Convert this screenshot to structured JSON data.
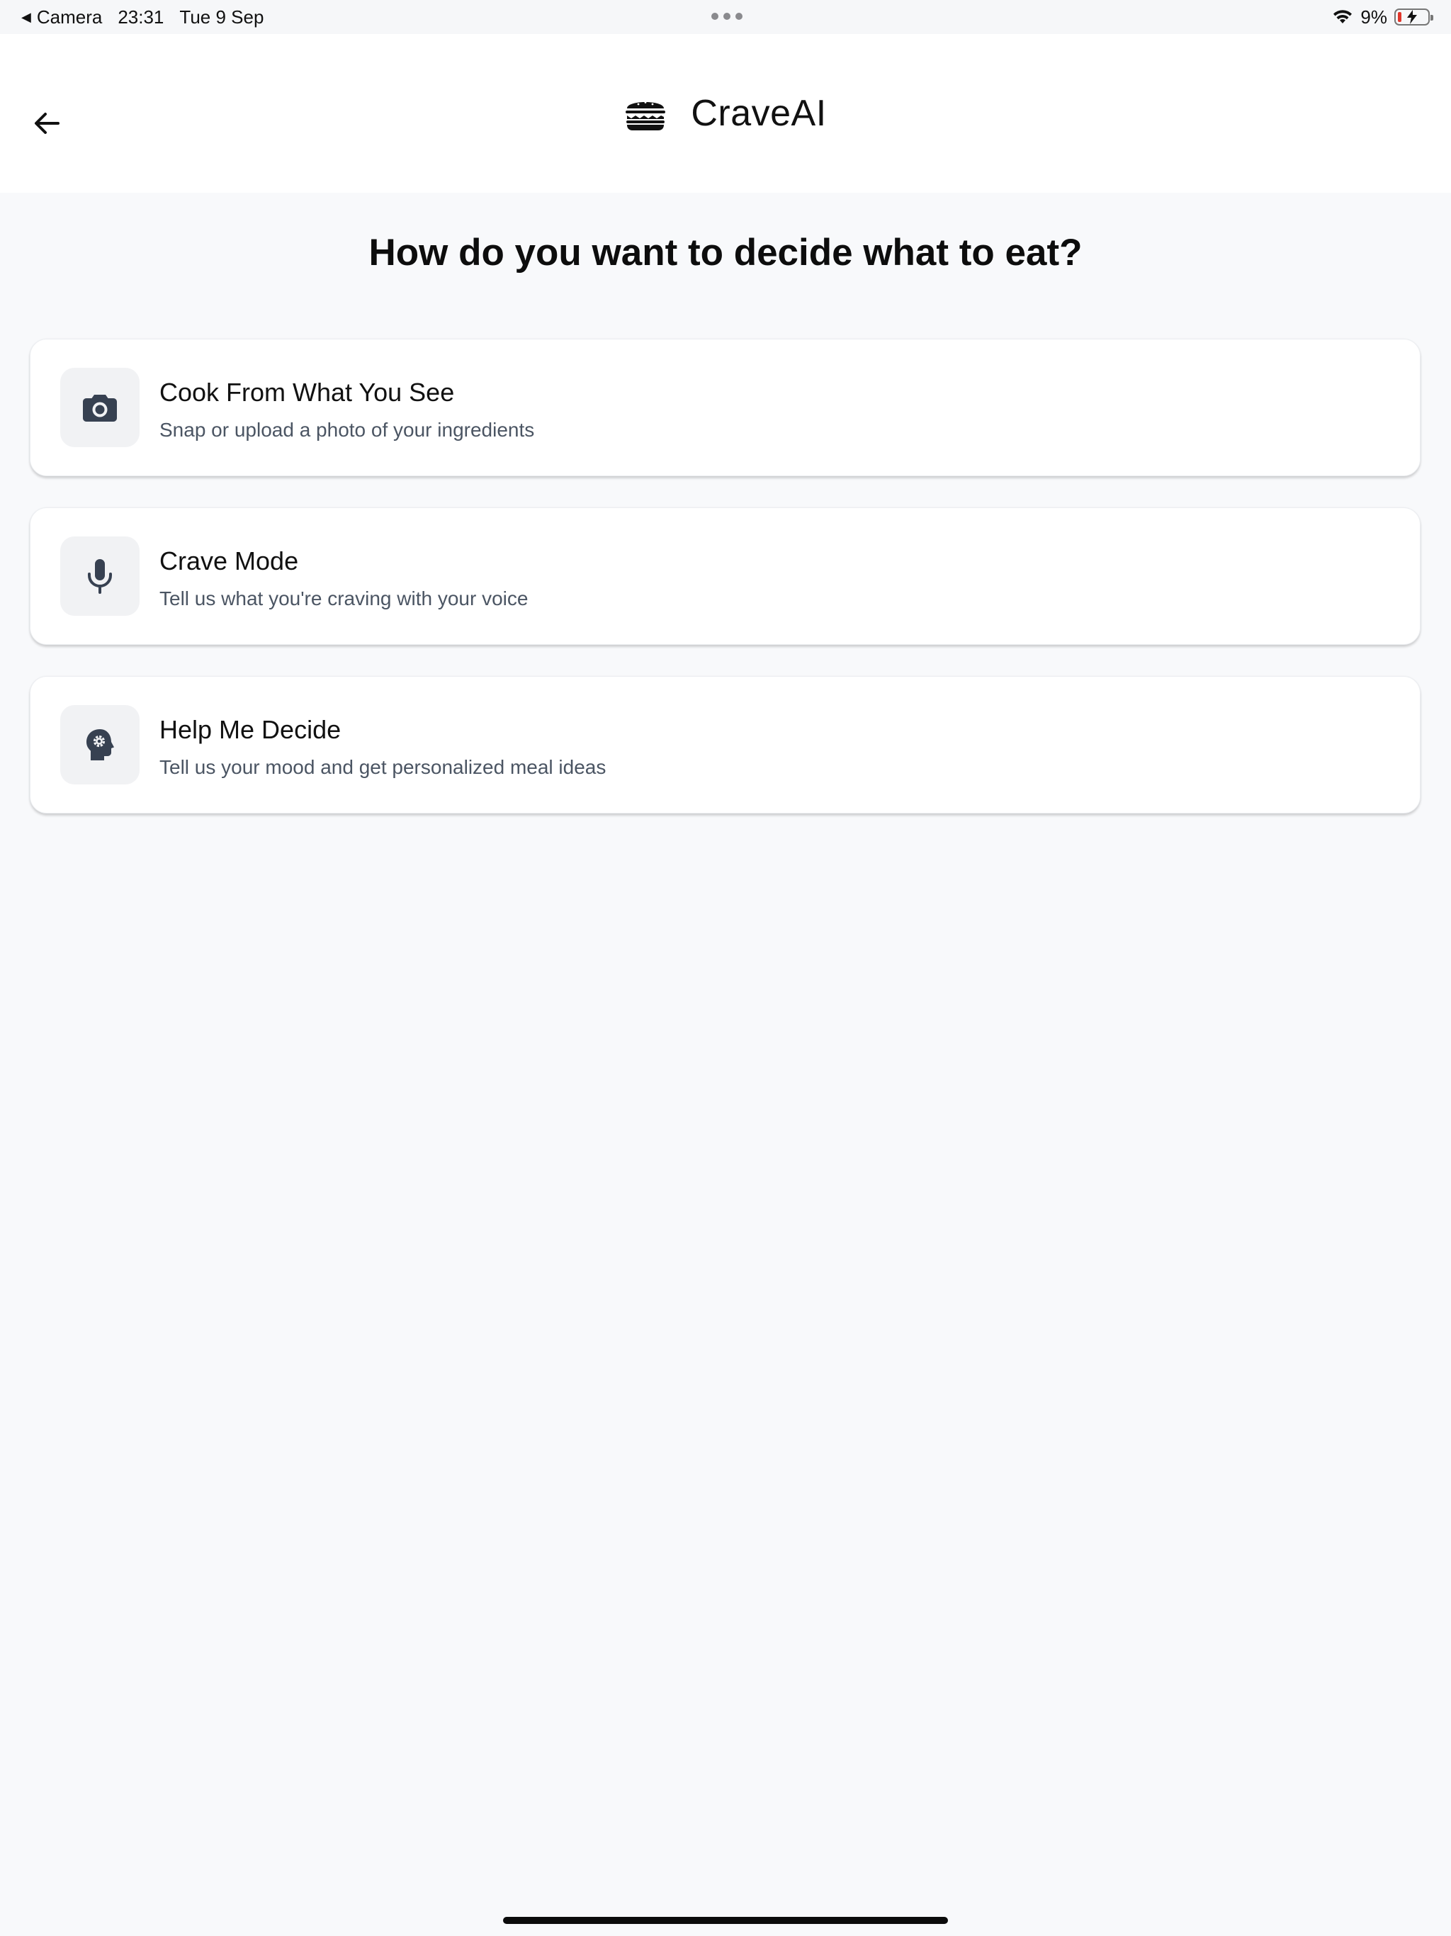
{
  "status_bar": {
    "back_app": "Camera",
    "time": "23:31",
    "date": "Tue 9 Sep",
    "battery_percent": "9%",
    "battery_level": 0.09,
    "charging": true
  },
  "header": {
    "logo_icon": "burger-icon",
    "title": "CraveAI",
    "back_icon": "arrow-left-icon"
  },
  "main": {
    "title": "How do you want to decide what to eat?",
    "options": [
      {
        "icon": "camera-icon",
        "title": "Cook From What You See",
        "subtitle": "Snap or upload a photo of your ingredients"
      },
      {
        "icon": "microphone-icon",
        "title": "Crave Mode",
        "subtitle": "Tell us what you're craving with your voice"
      },
      {
        "icon": "head-gear-icon",
        "title": "Help Me Decide",
        "subtitle": "Tell us your mood and get personalized meal ideas"
      }
    ]
  },
  "colors": {
    "background": "#f8f9fb",
    "card": "#ffffff",
    "icon": "#374151",
    "subtitle": "#4b5563",
    "battery_low": "#e0362b"
  }
}
